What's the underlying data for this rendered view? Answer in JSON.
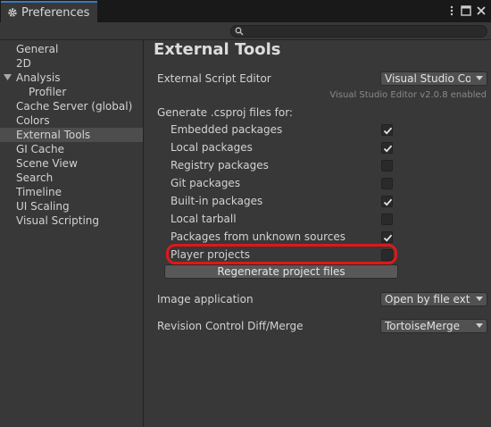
{
  "window": {
    "title": "Preferences",
    "icons": [
      "gear-icon",
      "kebab-menu-icon",
      "maximize-icon",
      "close-icon"
    ]
  },
  "search": {
    "placeholder": "",
    "icon": "search-icon"
  },
  "sidebar": {
    "items": [
      {
        "label": "General"
      },
      {
        "label": "2D"
      },
      {
        "label": "Analysis"
      },
      {
        "label": "Profiler"
      },
      {
        "label": "Cache Server (global)"
      },
      {
        "label": "Colors"
      },
      {
        "label": "External Tools"
      },
      {
        "label": "GI Cache"
      },
      {
        "label": "Scene View"
      },
      {
        "label": "Search"
      },
      {
        "label": "Timeline"
      },
      {
        "label": "UI Scaling"
      },
      {
        "label": "Visual Scripting"
      }
    ],
    "selected": "External Tools"
  },
  "main": {
    "title": "External Tools",
    "script_editor": {
      "label": "External Script Editor",
      "value": "Visual Studio Community",
      "subtext": "Visual Studio Editor v2.0.8 enabled"
    },
    "csproj": {
      "label": "Generate .csproj files for:",
      "options": [
        {
          "label": "Embedded packages",
          "checked": true
        },
        {
          "label": "Local packages",
          "checked": true
        },
        {
          "label": "Registry packages",
          "checked": false
        },
        {
          "label": "Git packages",
          "checked": false
        },
        {
          "label": "Built-in packages",
          "checked": true
        },
        {
          "label": "Local tarball",
          "checked": false
        },
        {
          "label": "Packages from unknown sources",
          "checked": true
        },
        {
          "label": "Player projects",
          "checked": false
        }
      ],
      "regenerate_label": "Regenerate project files"
    },
    "image_application": {
      "label": "Image application",
      "value": "Open by file extension"
    },
    "revision_control": {
      "label": "Revision Control Diff/Merge",
      "value": "TortoiseMerge"
    }
  },
  "colors": {
    "highlight": "#e0171b",
    "tab_accent": "#3a79bb"
  }
}
